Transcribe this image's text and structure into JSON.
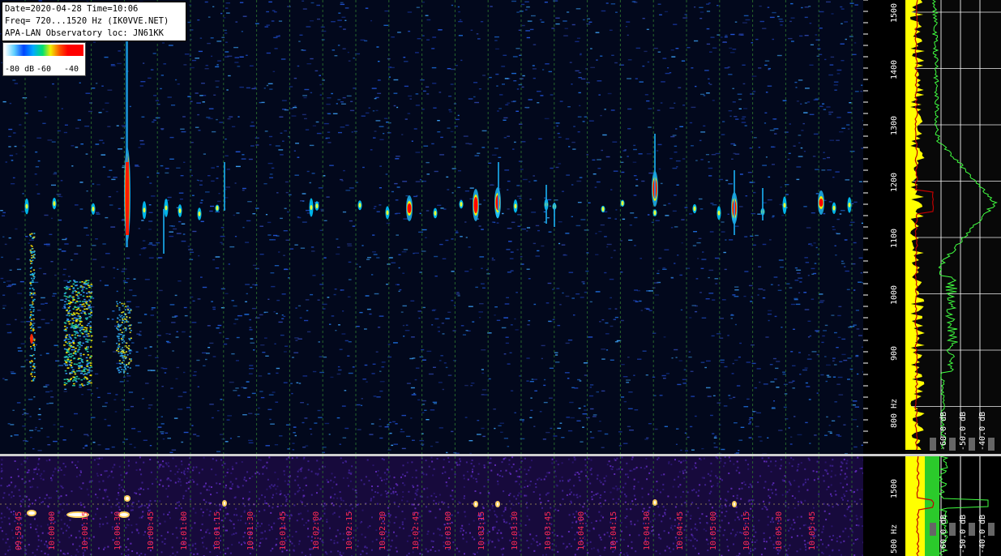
{
  "info": {
    "line1": "Date=2020-04-28 Time=10:06",
    "line2": "Freq= 720...1520 Hz (IK0VVE.NET)",
    "line3": "APA-LAN Observatory loc: JN61KK"
  },
  "legend": {
    "labels": [
      "-80 dB",
      "-60",
      "-40"
    ]
  },
  "freq_axis": {
    "labels": [
      "1500",
      "1400",
      "1300",
      "1200",
      "1100",
      "1000",
      "900",
      "800 Hz"
    ],
    "unit": "Hz"
  },
  "freq_axis_bottom": {
    "labels": [
      "1500",
      "500 Hz"
    ]
  },
  "db_labels": [
    "-60.0 dB",
    "-50.0 dB",
    "-40.0 dB"
  ],
  "time_labels": [
    "09:59:45",
    "10:00:00",
    "10:00:15",
    "10:00:30",
    "10:00:45",
    "10:01:00",
    "10:01:15",
    "10:01:30",
    "10:01:45",
    "10:02:00",
    "10:02:15",
    "10:02:30",
    "10:02:45",
    "10:03:00",
    "10:03:15",
    "10:03:30",
    "10:03:45",
    "10:04:00",
    "10:04:15",
    "10:04:30",
    "10:04:45",
    "10:05:00",
    "10:05:15",
    "10:05:30",
    "10:05:45"
  ],
  "colors": {
    "signal_strong": "#ff0000",
    "signal_mid": "#f0f000",
    "signal_low": "#00c0ff",
    "grid": "#2a7a2a",
    "spectrum_avg": "#ffff00",
    "spectrum_peak": "#40ff40"
  }
}
